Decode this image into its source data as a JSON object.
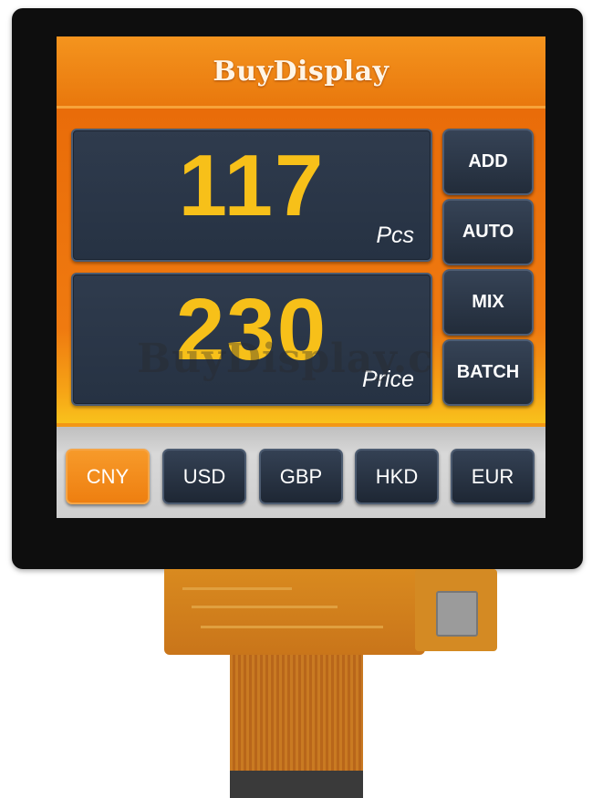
{
  "brand": {
    "logo_text": "BuyDisplay",
    "watermark_text": "BuyDisplay.c"
  },
  "counter": {
    "value": "117",
    "unit": "Pcs"
  },
  "price": {
    "value": "230",
    "unit": "Price"
  },
  "side_buttons": [
    {
      "label": "ADD"
    },
    {
      "label": "AUTO"
    },
    {
      "label": "MIX"
    },
    {
      "label": "BATCH"
    }
  ],
  "currencies": [
    {
      "label": "CNY",
      "active": true
    },
    {
      "label": "USD",
      "active": false
    },
    {
      "label": "GBP",
      "active": false
    },
    {
      "label": "HKD",
      "active": false
    },
    {
      "label": "EUR",
      "active": false
    }
  ],
  "colors": {
    "accent_orange": "#ee7f10",
    "value_yellow": "#f7c019",
    "panel_navy": "#263243"
  }
}
